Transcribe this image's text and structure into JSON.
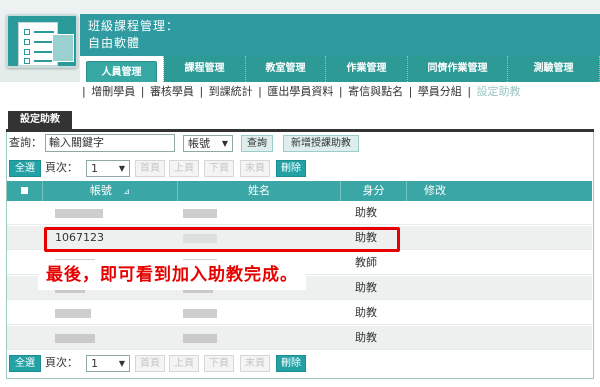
{
  "app": {
    "title_line1": "班級課程管理：",
    "title_line2": "自由軟體"
  },
  "tabs": [
    {
      "label": "人員管理",
      "active": true
    },
    {
      "label": "課程管理",
      "active": false
    },
    {
      "label": "教室管理",
      "active": false
    },
    {
      "label": "作業管理",
      "active": false
    },
    {
      "label": "同儕作業管理",
      "active": false
    },
    {
      "label": "測驗管理",
      "active": false
    }
  ],
  "subnav": {
    "items": [
      "增刪學員",
      "審核學員",
      "到課統計",
      "匯出學員資料",
      "寄信與點名",
      "學員分組",
      "設定助教"
    ],
    "current": "設定助教"
  },
  "panel": {
    "tab_label": "設定助教",
    "search": {
      "label": "查詢：",
      "value": "輸入關鍵字",
      "field_select": "帳號",
      "search_button": "查詢",
      "add_button": "新增授課助教"
    },
    "pager": {
      "select_all": "全選",
      "page_label": "頁次：",
      "page_value": "1",
      "first": "首頁",
      "prev": "上頁",
      "next": "下頁",
      "last": "末頁",
      "delete": "刪除"
    },
    "table": {
      "headers": {
        "account": "帳號",
        "sort_indicator": "⊿",
        "name": "姓名",
        "role": "身分",
        "edit": "修改"
      },
      "rows": [
        {
          "account": "",
          "name": "",
          "role": "助教",
          "masked": true
        },
        {
          "account": "1067123",
          "name": "",
          "role": "助教",
          "masked": false
        },
        {
          "account": "",
          "name": "",
          "role": "教師",
          "masked": true
        },
        {
          "account": "",
          "name": "",
          "role": "助教",
          "masked": true
        },
        {
          "account": "",
          "name": "",
          "role": "助教",
          "masked": true
        },
        {
          "account": "",
          "name": "",
          "role": "助教",
          "masked": true
        }
      ]
    }
  },
  "annotation": {
    "text": "最後，即可看到加入助教完成。",
    "color": "#e60000"
  },
  "colors": {
    "brand": "#2f9aa0",
    "header_row": "#3aa6a6",
    "accent_button": "#23a2a5"
  }
}
